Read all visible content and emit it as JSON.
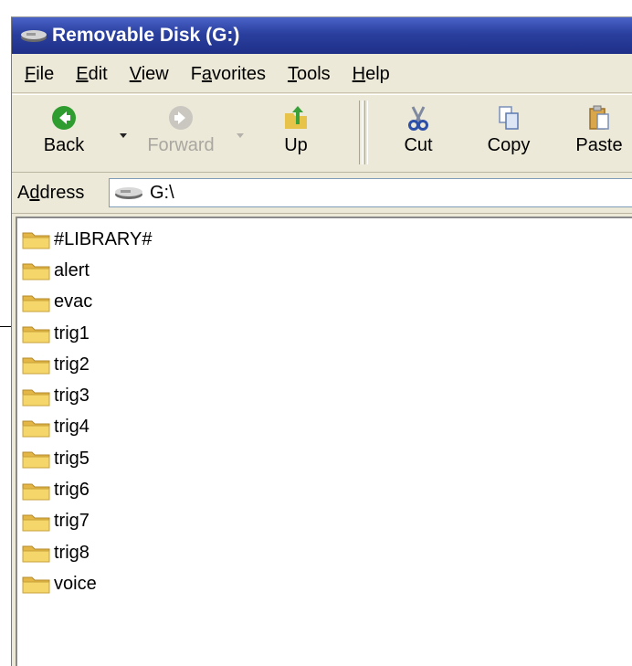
{
  "window": {
    "title": "Removable Disk (G:)",
    "title_icon": "removable-drive-icon"
  },
  "menu": [
    {
      "id": "file",
      "pre": "",
      "ul": "F",
      "post": "ile"
    },
    {
      "id": "edit",
      "pre": "",
      "ul": "E",
      "post": "dit"
    },
    {
      "id": "view",
      "pre": "",
      "ul": "V",
      "post": "iew"
    },
    {
      "id": "favorites",
      "pre": "F",
      "ul": "a",
      "post": "vorites"
    },
    {
      "id": "tools",
      "pre": "",
      "ul": "T",
      "post": "ools"
    },
    {
      "id": "help",
      "pre": "",
      "ul": "H",
      "post": "elp"
    }
  ],
  "toolbar": {
    "back_label": "Back",
    "forward_label": "Forward",
    "up_label": "Up",
    "cut_label": "Cut",
    "copy_label": "Copy",
    "paste_label": "Paste"
  },
  "address": {
    "label_pre": "A",
    "label_ul": "d",
    "label_post": "dress",
    "value": "G:\\"
  },
  "files": [
    {
      "name": "#LIBRARY#",
      "icon": "folder-icon"
    },
    {
      "name": "alert",
      "icon": "folder-icon"
    },
    {
      "name": "evac",
      "icon": "folder-icon"
    },
    {
      "name": "trig1",
      "icon": "folder-icon"
    },
    {
      "name": "trig2",
      "icon": "folder-icon"
    },
    {
      "name": "trig3",
      "icon": "folder-icon"
    },
    {
      "name": "trig4",
      "icon": "folder-icon"
    },
    {
      "name": "trig5",
      "icon": "folder-icon"
    },
    {
      "name": "trig6",
      "icon": "folder-icon"
    },
    {
      "name": "trig7",
      "icon": "folder-icon"
    },
    {
      "name": "trig8",
      "icon": "folder-icon"
    },
    {
      "name": "voice",
      "icon": "folder-icon"
    }
  ],
  "colors": {
    "titlebar": "#2a3f9e",
    "chrome": "#ece9d8",
    "folder": "#f5d66b"
  }
}
